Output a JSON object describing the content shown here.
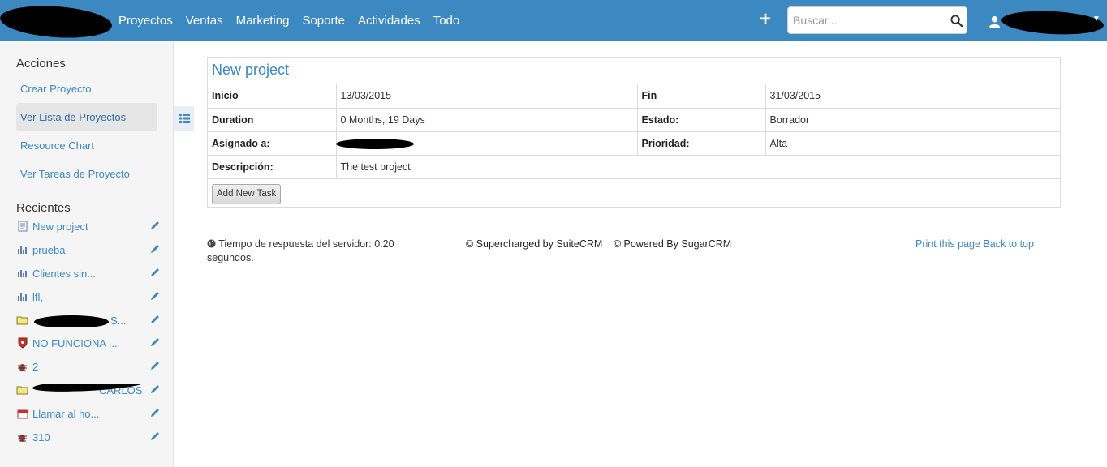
{
  "nav": {
    "items": [
      "Proyectos",
      "Ventas",
      "Marketing",
      "Soporte",
      "Actividades",
      "Todo"
    ],
    "search_placeholder": "Buscar..."
  },
  "sidebar": {
    "actions_title": "Acciones",
    "actions": [
      "Crear Proyecto",
      "Ver Lista de Proyectos",
      "Resource Chart",
      "Ver Tareas de Proyecto"
    ],
    "recent_title": "Recientes",
    "recent": [
      {
        "label": "New project",
        "icon": "project-icon"
      },
      {
        "label": "prueba",
        "icon": "chart-icon"
      },
      {
        "label": "Clientes sin...",
        "icon": "chart-icon"
      },
      {
        "label": "lfl,",
        "icon": "chart-icon"
      },
      {
        "label": "S...",
        "icon": "folder-icon"
      },
      {
        "label": "NO FUNCIONA ...",
        "icon": "shield-icon"
      },
      {
        "label": "2",
        "icon": "bug-icon"
      },
      {
        "label": "CARLOS",
        "icon": "folder-icon"
      },
      {
        "label": "Llamar al ho...",
        "icon": "calendar-icon"
      },
      {
        "label": "310",
        "icon": "bug-icon"
      }
    ]
  },
  "detail": {
    "title": "New project",
    "start_label": "Inicio",
    "start_value": "13/03/2015",
    "end_label": "Fin",
    "end_value": "31/03/2015",
    "duration_label": "Duration",
    "duration_value": "0 Months, 19 Days",
    "status_label": "Estado:",
    "status_value": "Borrador",
    "assigned_label": "Asignado a:",
    "priority_label": "Prioridad:",
    "priority_value": "Alta",
    "description_label": "Descripción:",
    "description_value": "The test project",
    "add_task_button": "Add New Task"
  },
  "footer": {
    "response_time": "Tiempo de respuesta del servidor: 0.20 segundos.",
    "supercharged": "© Supercharged by SuiteCRM",
    "powered": "© Powered By SugarCRM",
    "print": "Print this page",
    "back_to_top": "Back to top"
  },
  "colors": {
    "accent": "#3c88c0",
    "sidebar_bg": "#f5f5f5"
  }
}
